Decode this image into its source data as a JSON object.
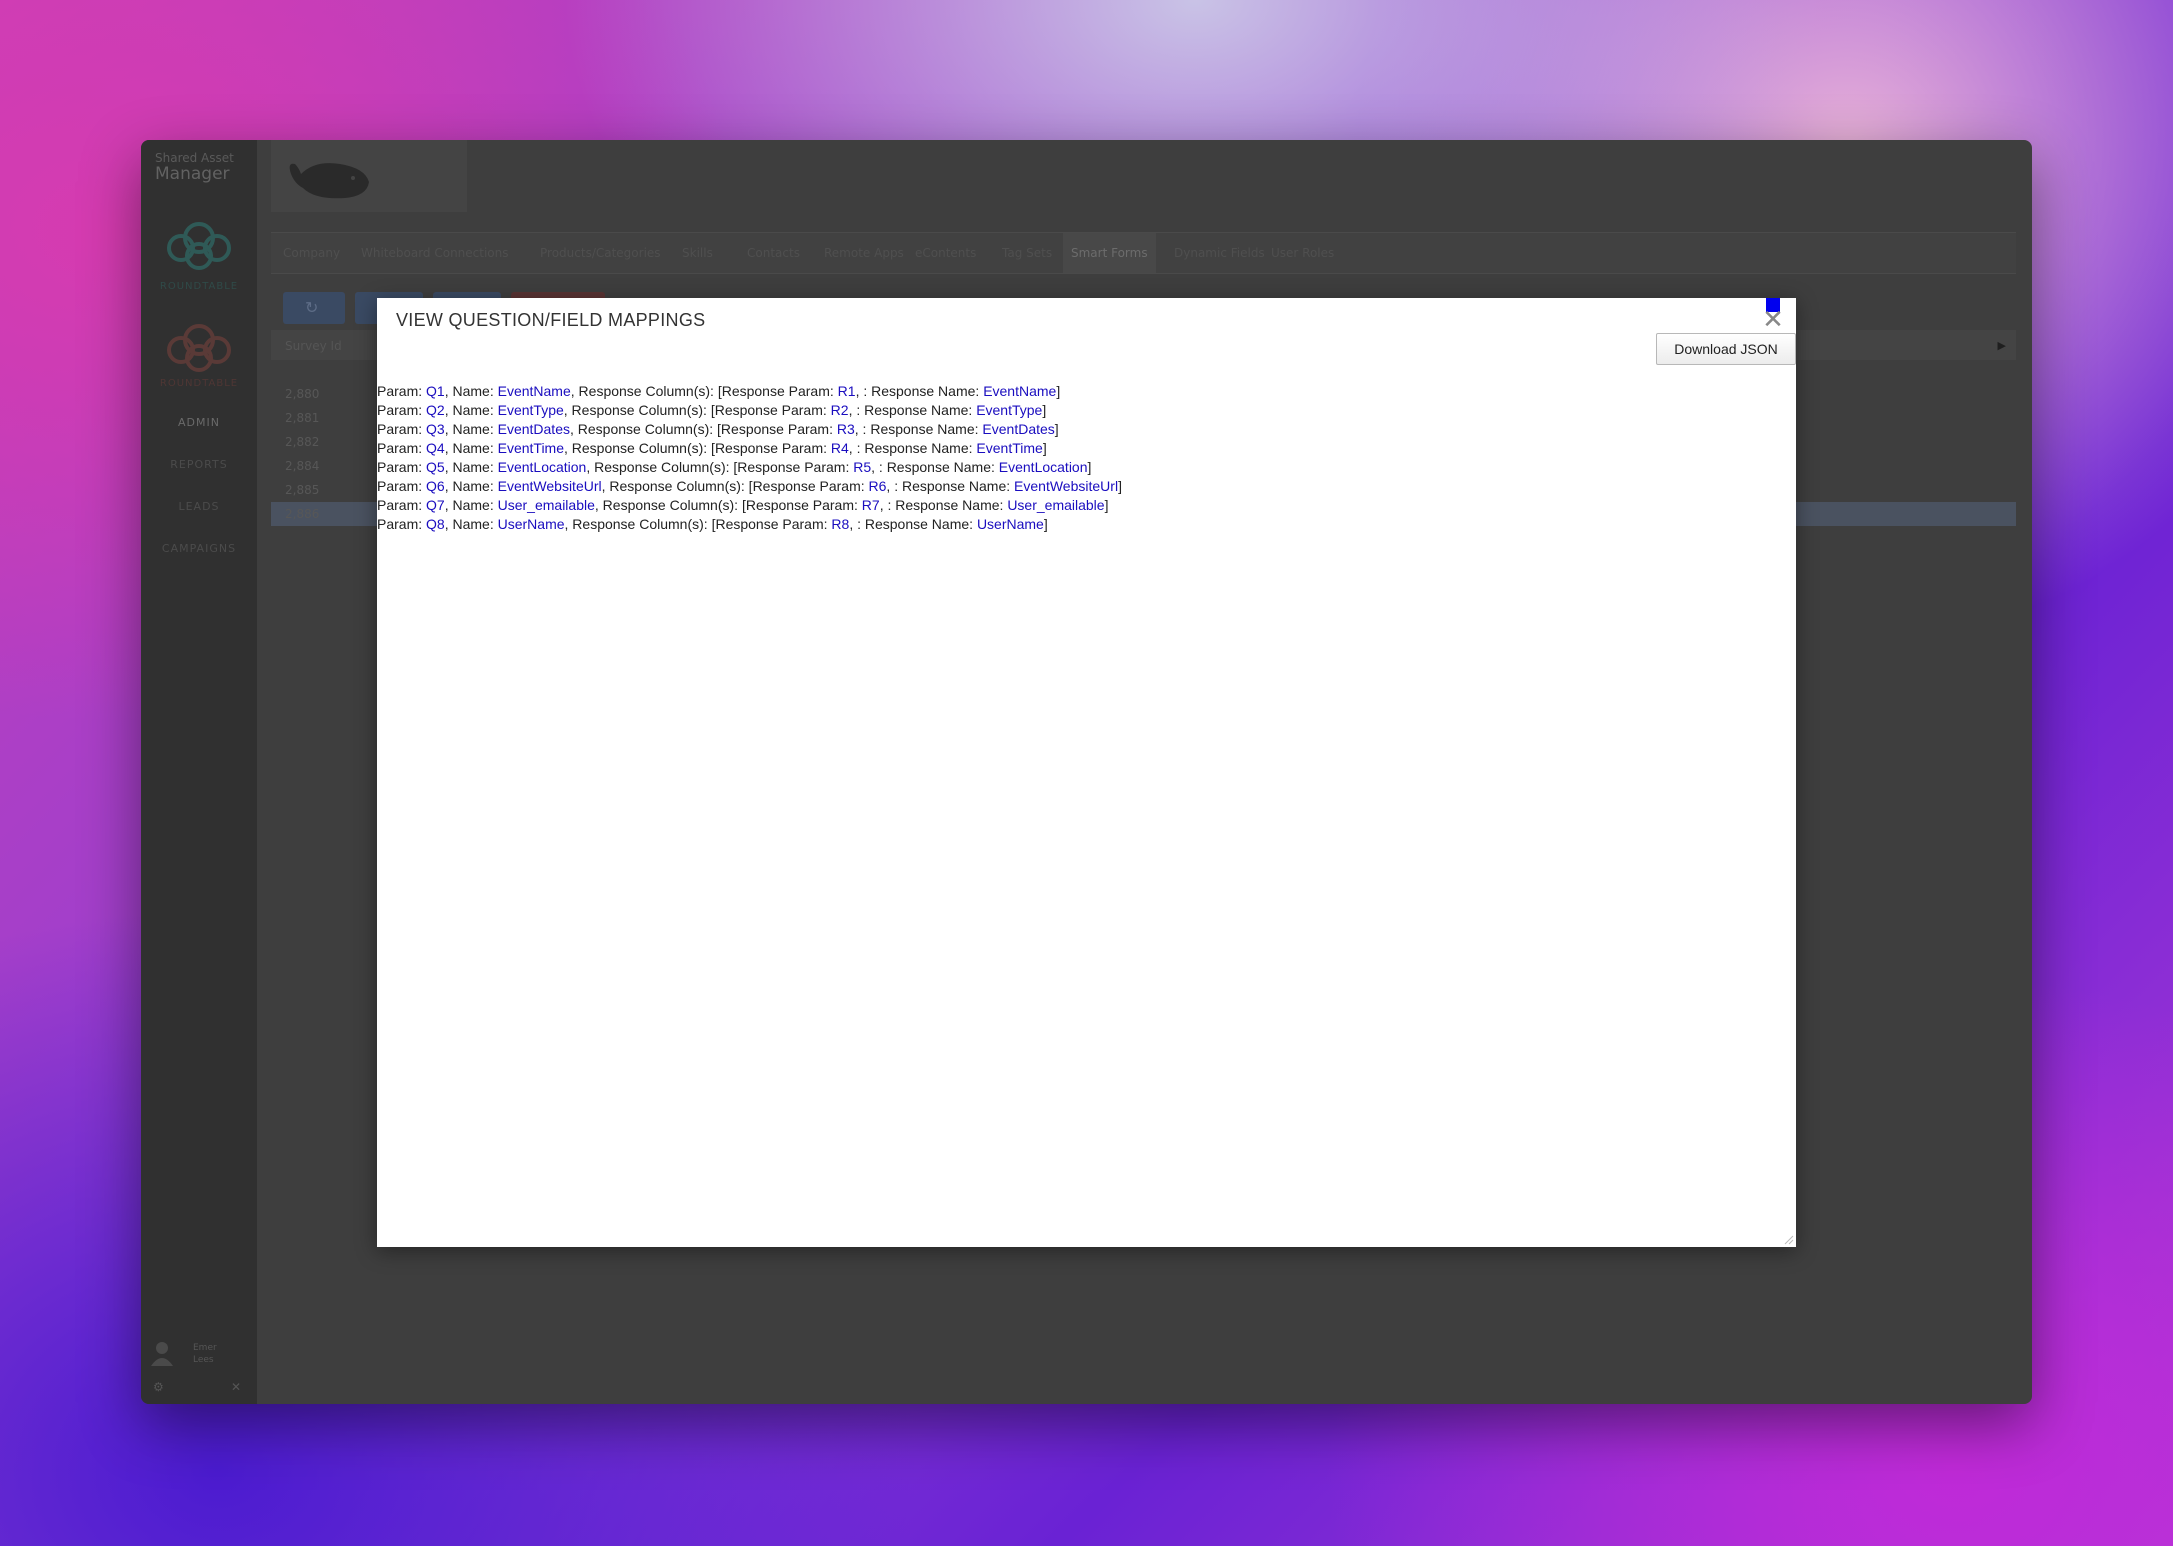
{
  "app": {
    "brand_small": "Shared Asset",
    "brand_big": "Manager",
    "logo_labels": [
      "ROUNDTABLE",
      "ROUNDTABLE"
    ],
    "nav": [
      "ADMIN",
      "REPORTS",
      "LEADS",
      "CAMPAIGNS"
    ],
    "user_name_line1": "Emer",
    "user_name_line2": "Lees"
  },
  "tabs": [
    "Company",
    "Whiteboard Connections",
    "Products/Categories",
    "Skills",
    "Contacts",
    "Remote Apps",
    "eContents",
    "Tag Sets",
    "Smart Forms",
    "Dynamic Fields",
    "User Roles"
  ],
  "grid": {
    "header": "Survey Id",
    "rows": [
      "2,880",
      "2,881",
      "2,882",
      "2,884",
      "2,885",
      "2,886"
    ]
  },
  "modal": {
    "title": "VIEW QUESTION/FIELD MAPPINGS",
    "close_symbol": "✕",
    "download_label": "Download JSON",
    "text": {
      "param": "Param: ",
      "name": ", Name: ",
      "response_columns": ", Response Column(s): [Response Param: ",
      "response_name": ", : Response Name: ",
      "close_bracket": "]"
    },
    "mappings": [
      {
        "param": "Q1",
        "name": "EventName",
        "response_param": "R1",
        "response_name": "EventName"
      },
      {
        "param": "Q2",
        "name": "EventType",
        "response_param": "R2",
        "response_name": "EventType"
      },
      {
        "param": "Q3",
        "name": "EventDates",
        "response_param": "R3",
        "response_name": "EventDates"
      },
      {
        "param": "Q4",
        "name": "EventTime",
        "response_param": "R4",
        "response_name": "EventTime"
      },
      {
        "param": "Q5",
        "name": "EventLocation",
        "response_param": "R5",
        "response_name": "EventLocation"
      },
      {
        "param": "Q6",
        "name": "EventWebsiteUrl",
        "response_param": "R6",
        "response_name": "EventWebsiteUrl"
      },
      {
        "param": "Q7",
        "name": "User_emailable",
        "response_param": "R7",
        "response_name": "User_emailable"
      },
      {
        "param": "Q8",
        "name": "UserName",
        "response_param": "R8",
        "response_name": "UserName"
      }
    ]
  },
  "colors": {
    "link": "#1a0dbf",
    "focus_marker": "#0000ee",
    "dimmed_teal": "#2f5a57",
    "dimmed_red": "#5a3a37"
  }
}
